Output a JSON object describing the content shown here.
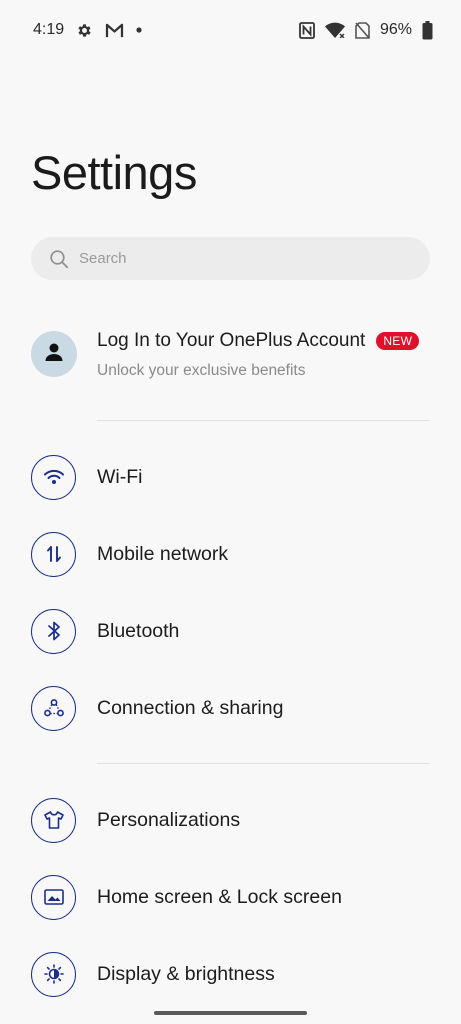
{
  "status_bar": {
    "time": "4:19",
    "battery": "96%",
    "icons_left": [
      "gear-icon",
      "gmail-icon",
      "dot-icon"
    ],
    "icons_right": [
      "nfc-icon",
      "wifi-icon",
      "no-sim-icon",
      "battery-icon"
    ]
  },
  "page": {
    "title": "Settings"
  },
  "search": {
    "placeholder": "Search"
  },
  "account": {
    "title": "Log In to Your OnePlus Account",
    "badge": "NEW",
    "subtitle": "Unlock your exclusive benefits"
  },
  "groups": [
    {
      "items": [
        {
          "label": "Wi-Fi",
          "icon": "wifi-icon"
        },
        {
          "label": "Mobile network",
          "icon": "mobile-data-icon"
        },
        {
          "label": "Bluetooth",
          "icon": "bluetooth-icon"
        },
        {
          "label": "Connection & sharing",
          "icon": "share-network-icon"
        }
      ]
    },
    {
      "items": [
        {
          "label": "Personalizations",
          "icon": "tshirt-icon"
        },
        {
          "label": "Home screen & Lock screen",
          "icon": "image-icon"
        },
        {
          "label": "Display & brightness",
          "icon": "brightness-icon"
        }
      ]
    }
  ],
  "colors": {
    "icon_accent": "#1a2e8a",
    "badge_red": "#e0102a",
    "background": "#f8f8f8",
    "avatar_bg": "#c9dae5"
  }
}
